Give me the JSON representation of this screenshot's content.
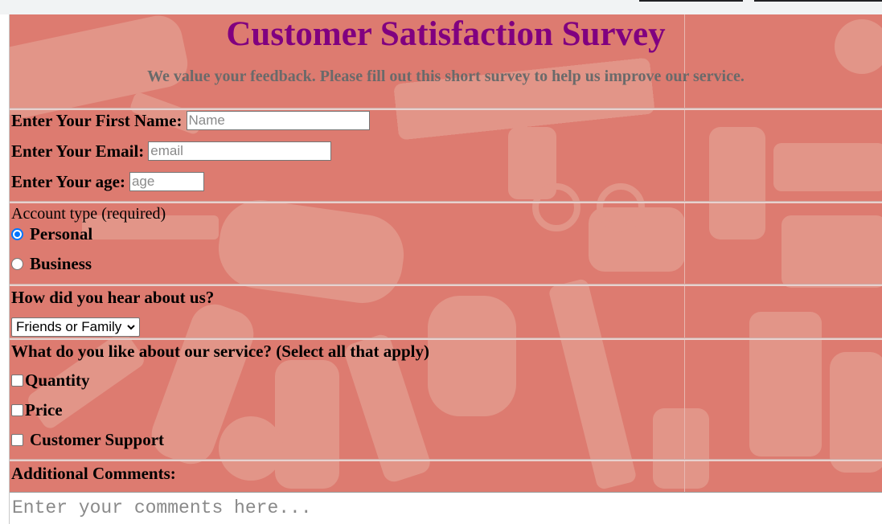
{
  "header": {
    "title": "Customer Satisfaction Survey",
    "subtitle": "We value your feedback. Please fill out this short survey to help us improve our service."
  },
  "personal": {
    "first_name_label": "Enter Your First Name:",
    "first_name_placeholder": "Name",
    "email_label": "Enter Your Email:",
    "email_placeholder": "email",
    "age_label": "Enter Your age:",
    "age_placeholder": "age"
  },
  "account": {
    "legend": "Account type (required)",
    "options": [
      {
        "label": "Personal",
        "checked": true
      },
      {
        "label": "Business",
        "checked": false
      }
    ]
  },
  "referral": {
    "question": "How did you hear about us?",
    "selected": "Friends or Family"
  },
  "likes": {
    "question": "What do you like about our service? (Select all that apply)",
    "options": [
      {
        "label": "Quantity",
        "checked": false
      },
      {
        "label": "Price",
        "checked": false
      },
      {
        "label": "Customer Support",
        "checked": false
      }
    ]
  },
  "comments": {
    "label": "Additional Comments:",
    "placeholder": "Enter your comments here..."
  },
  "colors": {
    "background": "#dd7b70",
    "title": "#800080",
    "subtitle": "#6a6a6a"
  }
}
